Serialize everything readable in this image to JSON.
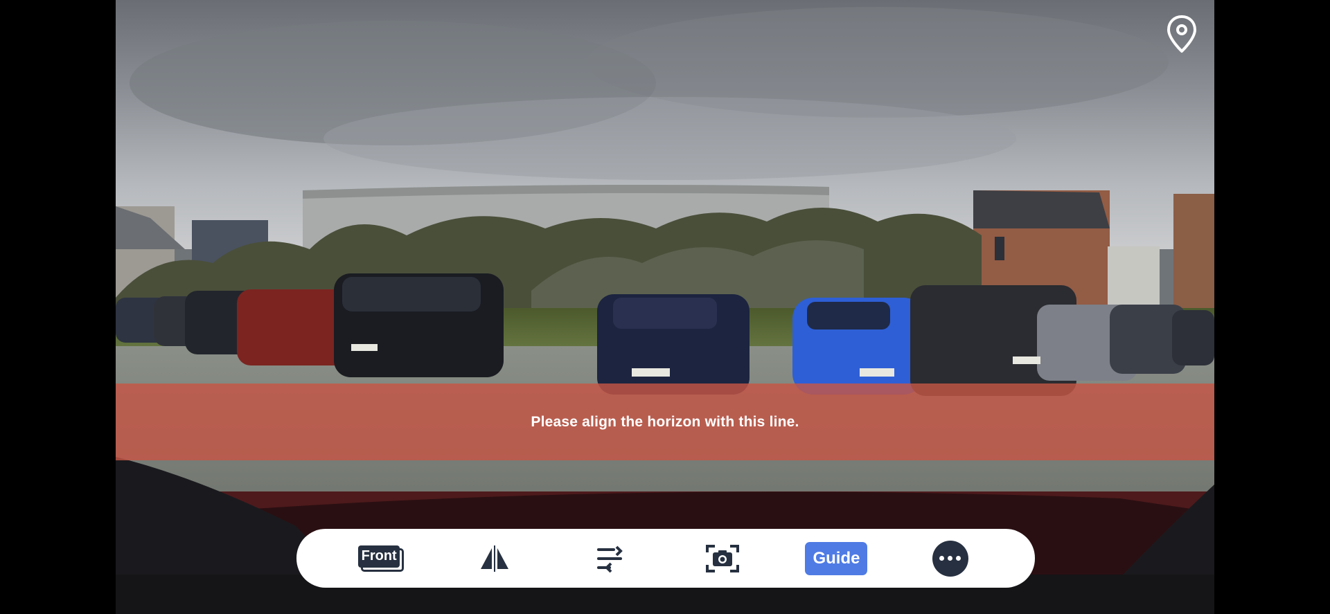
{
  "overlay": {
    "horizon_instruction": "Please align the horizon with this line."
  },
  "toolbar": {
    "front_label": "Front",
    "guide_label": "Guide",
    "items": [
      "front",
      "mirror",
      "level",
      "screenshot",
      "guide",
      "more"
    ]
  },
  "colors": {
    "horizon_band": "#c45646",
    "toolbar_bg": "#ffffff",
    "icon_dark": "#263040",
    "guide_accent": "#4f7be4"
  },
  "icons": {
    "top_right": "location-pin-icon",
    "mirror": "mirror-flip-icon",
    "level": "horizon-align-icon",
    "screenshot": "camera-capture-icon",
    "more": "more-dots-icon"
  }
}
